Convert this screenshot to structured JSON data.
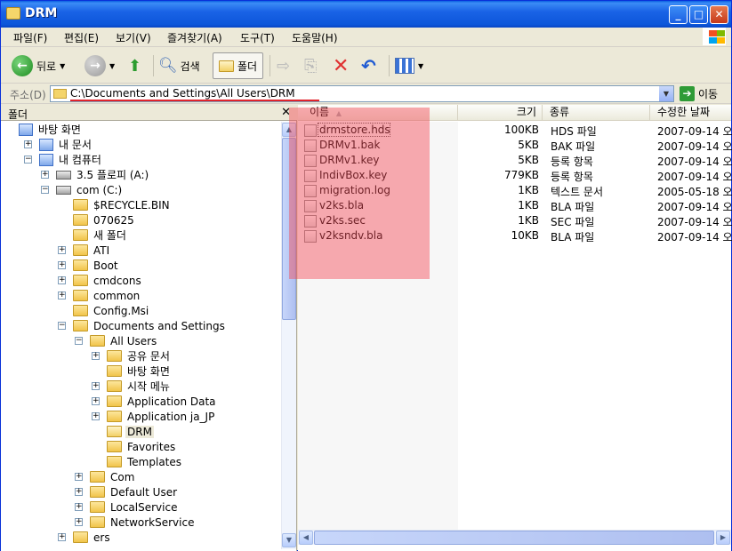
{
  "window": {
    "title": "DRM"
  },
  "menu": [
    "파일(F)",
    "편집(E)",
    "보기(V)",
    "즐겨찾기(A)",
    "도구(T)",
    "도움말(H)"
  ],
  "toolbar": {
    "back": "뒤로",
    "search": "검색",
    "folders": "폴더"
  },
  "address": {
    "label": "주소(D)",
    "path": "C:\\Documents and Settings\\All Users\\DRM",
    "go": "이동"
  },
  "folder_pane": {
    "title": "폴더",
    "tree": [
      {
        "label": "바탕 화면",
        "level": 0,
        "exp": "",
        "icon": "sys"
      },
      {
        "label": "내 문서",
        "level": 1,
        "exp": "+",
        "icon": "sys"
      },
      {
        "label": "내 컴퓨터",
        "level": 1,
        "exp": "-",
        "icon": "sys"
      },
      {
        "label": "3.5 플로피 (A:)",
        "level": 2,
        "exp": "+",
        "icon": "drive"
      },
      {
        "label": "com (C:)",
        "level": 2,
        "exp": "-",
        "icon": "drive"
      },
      {
        "label": "$RECYCLE.BIN",
        "level": 3,
        "exp": "",
        "icon": "folder"
      },
      {
        "label": "070625",
        "level": 3,
        "exp": "",
        "icon": "folder"
      },
      {
        "label": "새 폴더",
        "level": 3,
        "exp": "",
        "icon": "folder"
      },
      {
        "label": "ATI",
        "level": 3,
        "exp": "+",
        "icon": "folder"
      },
      {
        "label": "Boot",
        "level": 3,
        "exp": "+",
        "icon": "folder"
      },
      {
        "label": "cmdcons",
        "level": 3,
        "exp": "+",
        "icon": "folder"
      },
      {
        "label": "common",
        "level": 3,
        "exp": "+",
        "icon": "folder"
      },
      {
        "label": "Config.Msi",
        "level": 3,
        "exp": "",
        "icon": "folder"
      },
      {
        "label": "Documents and Settings",
        "level": 3,
        "exp": "-",
        "icon": "folder"
      },
      {
        "label": "All Users",
        "level": 4,
        "exp": "-",
        "icon": "folder"
      },
      {
        "label": "공유 문서",
        "level": 5,
        "exp": "+",
        "icon": "folder"
      },
      {
        "label": "바탕 화면",
        "level": 5,
        "exp": "",
        "icon": "folder"
      },
      {
        "label": "시작 메뉴",
        "level": 5,
        "exp": "+",
        "icon": "folder"
      },
      {
        "label": "Application Data",
        "level": 5,
        "exp": "+",
        "icon": "folder"
      },
      {
        "label": "Application ja_JP",
        "level": 5,
        "exp": "+",
        "icon": "folder"
      },
      {
        "label": "DRM",
        "level": 5,
        "exp": "",
        "icon": "folder-open",
        "selected": true
      },
      {
        "label": "Favorites",
        "level": 5,
        "exp": "",
        "icon": "folder"
      },
      {
        "label": "Templates",
        "level": 5,
        "exp": "",
        "icon": "folder"
      },
      {
        "label": "Com",
        "level": 4,
        "exp": "+",
        "icon": "folder"
      },
      {
        "label": "Default User",
        "level": 4,
        "exp": "+",
        "icon": "folder"
      },
      {
        "label": "LocalService",
        "level": 4,
        "exp": "+",
        "icon": "folder"
      },
      {
        "label": "NetworkService",
        "level": 4,
        "exp": "+",
        "icon": "folder"
      },
      {
        "label": "ers",
        "level": 3,
        "exp": "+",
        "icon": "folder"
      }
    ]
  },
  "file_pane": {
    "columns": {
      "name": "이름",
      "size": "크기",
      "type": "종류",
      "date": "수정한 날짜"
    },
    "files": [
      {
        "name": "drmstore.hds",
        "size": "100KB",
        "type": "HDS 파일",
        "date": "2007-09-14 오"
      },
      {
        "name": "DRMv1.bak",
        "size": "5KB",
        "type": "BAK 파일",
        "date": "2007-09-14 오"
      },
      {
        "name": "DRMv1.key",
        "size": "5KB",
        "type": "등록 항목",
        "date": "2007-09-14 오"
      },
      {
        "name": "IndivBox.key",
        "size": "779KB",
        "type": "등록 항목",
        "date": "2007-09-14 오"
      },
      {
        "name": "migration.log",
        "size": "1KB",
        "type": "텍스트 문서",
        "date": "2005-05-18 오"
      },
      {
        "name": "v2ks.bla",
        "size": "1KB",
        "type": "BLA 파일",
        "date": "2007-09-14 오"
      },
      {
        "name": "v2ks.sec",
        "size": "1KB",
        "type": "SEC 파일",
        "date": "2007-09-14 오"
      },
      {
        "name": "v2ksndv.bla",
        "size": "10KB",
        "type": "BLA 파일",
        "date": "2007-09-14 오"
      }
    ]
  },
  "colors": {
    "titlebar": "#0a5fe0",
    "highlight": "#f54655",
    "address_underline": "#e0242c"
  }
}
